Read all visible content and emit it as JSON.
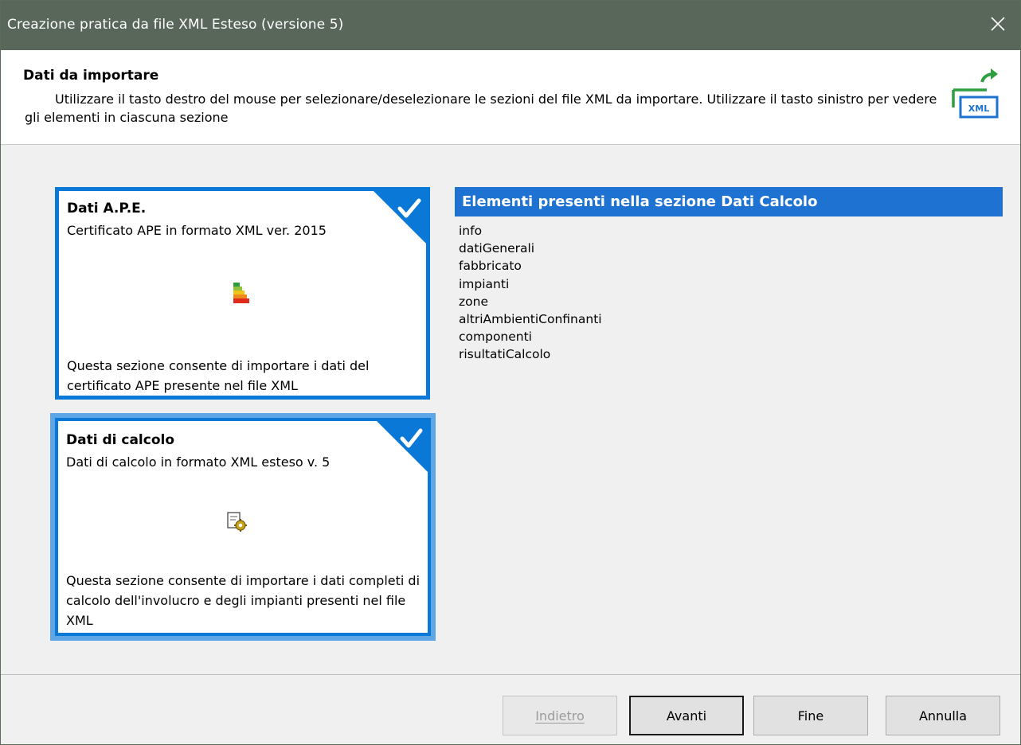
{
  "window": {
    "title": "Creazione pratica da file XML Esteso (versione 5)",
    "close_icon": "close-icon"
  },
  "header": {
    "title": "Dati da importare",
    "description": "Utilizzare il tasto destro del mouse per selezionare/deselezionare le sezioni del file XML da importare. Utilizzare il tasto sinistro per vedere gli elementi in ciascuna sezione",
    "icon": "xml-export-icon",
    "icon_label": "XML"
  },
  "sections": [
    {
      "title": "Dati A.P.E.",
      "subtitle": "Certificato APE in formato XML ver. 2015",
      "icon": "energy-class-icon",
      "description": "Questa sezione consente di importare i dati del certificato APE presente nel file XML",
      "checked": true
    },
    {
      "title": "Dati di calcolo",
      "subtitle": "Dati di calcolo in formato XML esteso v. 5",
      "icon": "calculation-gear-icon",
      "description": "Questa sezione consente di importare i dati completi di calcolo dell'involucro e degli impianti presenti nel file XML",
      "checked": true,
      "focused": true
    }
  ],
  "elements_panel": {
    "title": "Elementi presenti nella sezione Dati Calcolo",
    "items": [
      "info",
      "datiGenerali",
      "fabbricato",
      "impianti",
      "zone",
      "altriAmbientiConfinanti",
      "componenti",
      "risultatiCalcolo"
    ]
  },
  "buttons": {
    "back": "Indietro",
    "next": "Avanti",
    "finish": "Fine",
    "cancel": "Annulla"
  },
  "colors": {
    "titlebar": "#58675a",
    "accent": "#0a78d7",
    "panel_header": "#1e73d2"
  }
}
